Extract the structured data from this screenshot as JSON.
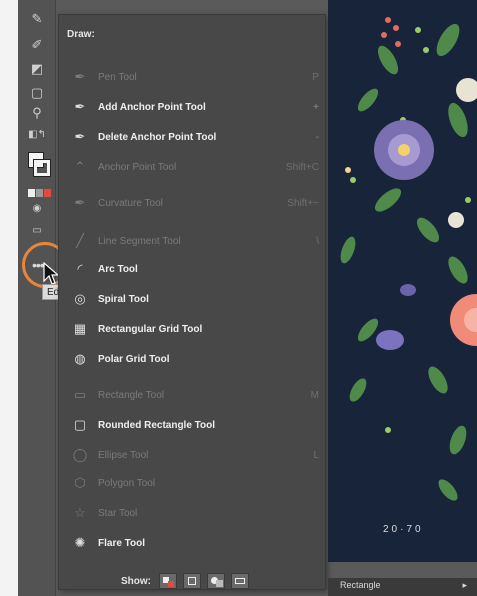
{
  "drawer": {
    "title": "Draw:",
    "tools": [
      {
        "label": "Pen Tool",
        "shortcut": "P",
        "enabled": false,
        "icon": "pen-icon"
      },
      {
        "label": "Add Anchor Point Tool",
        "shortcut": "+",
        "enabled": true,
        "icon": "add-anchor-point-icon"
      },
      {
        "label": "Delete Anchor Point Tool",
        "shortcut": "-",
        "enabled": true,
        "icon": "delete-anchor-point-icon"
      },
      {
        "label": "Anchor Point Tool",
        "shortcut": "Shift+C",
        "enabled": false,
        "icon": "anchor-point-icon"
      },
      {
        "label": "Curvature Tool",
        "shortcut": "Shift+~",
        "enabled": false,
        "icon": "curvature-icon"
      },
      {
        "label": "Line Segment Tool",
        "shortcut": "\\",
        "enabled": false,
        "icon": "line-segment-icon"
      },
      {
        "label": "Arc Tool",
        "shortcut": "",
        "enabled": true,
        "icon": "arc-icon"
      },
      {
        "label": "Spiral Tool",
        "shortcut": "",
        "enabled": true,
        "icon": "spiral-icon"
      },
      {
        "label": "Rectangular Grid Tool",
        "shortcut": "",
        "enabled": true,
        "icon": "rectangular-grid-icon"
      },
      {
        "label": "Polar Grid Tool",
        "shortcut": "",
        "enabled": true,
        "icon": "polar-grid-icon"
      },
      {
        "label": "Rectangle Tool",
        "shortcut": "M",
        "enabled": false,
        "icon": "rectangle-icon"
      },
      {
        "label": "Rounded Rectangle Tool",
        "shortcut": "",
        "enabled": true,
        "icon": "rounded-rectangle-icon"
      },
      {
        "label": "Ellipse Tool",
        "shortcut": "L",
        "enabled": false,
        "icon": "ellipse-icon"
      },
      {
        "label": "Polygon Tool",
        "shortcut": "",
        "enabled": false,
        "icon": "polygon-icon"
      },
      {
        "label": "Star Tool",
        "shortcut": "",
        "enabled": false,
        "icon": "star-icon"
      },
      {
        "label": "Flare Tool",
        "shortcut": "",
        "enabled": true,
        "icon": "flare-icon"
      }
    ],
    "show_label": "Show:"
  },
  "toolbar": {
    "tooltip": "Edit Toolbar..."
  },
  "artwork": {
    "text": "20·70"
  },
  "bottom_bar": {
    "label": "Rectangle",
    "arrow": "▸"
  },
  "colors": {
    "accent_ring": "#e8853a",
    "panel_bg": "#484848",
    "artboard_bg": "#18243a"
  }
}
